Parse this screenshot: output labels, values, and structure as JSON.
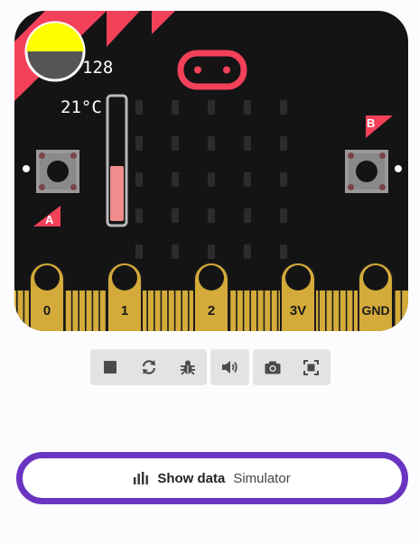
{
  "simulator": {
    "light_level": "128",
    "temperature": "21°C",
    "thermometer_level": 0.44,
    "buttons": {
      "a_label": "A",
      "b_label": "B"
    },
    "pins": [
      "0",
      "1",
      "2",
      "3V",
      "GND"
    ]
  },
  "toolbar": {
    "icons": [
      "stop-icon",
      "restart-icon",
      "debug-icon",
      "sound-icon",
      "screenshot-icon",
      "fullscreen-icon"
    ]
  },
  "show_data": {
    "label": "Show data",
    "sublabel": "Simulator"
  },
  "colors": {
    "board": "#141414",
    "accent_red": "#f4415a",
    "pin_gold": "#d4ab3a",
    "button_purple": "#6a34c2",
    "light_top": "#ffff00",
    "light_bottom": "#555555"
  }
}
